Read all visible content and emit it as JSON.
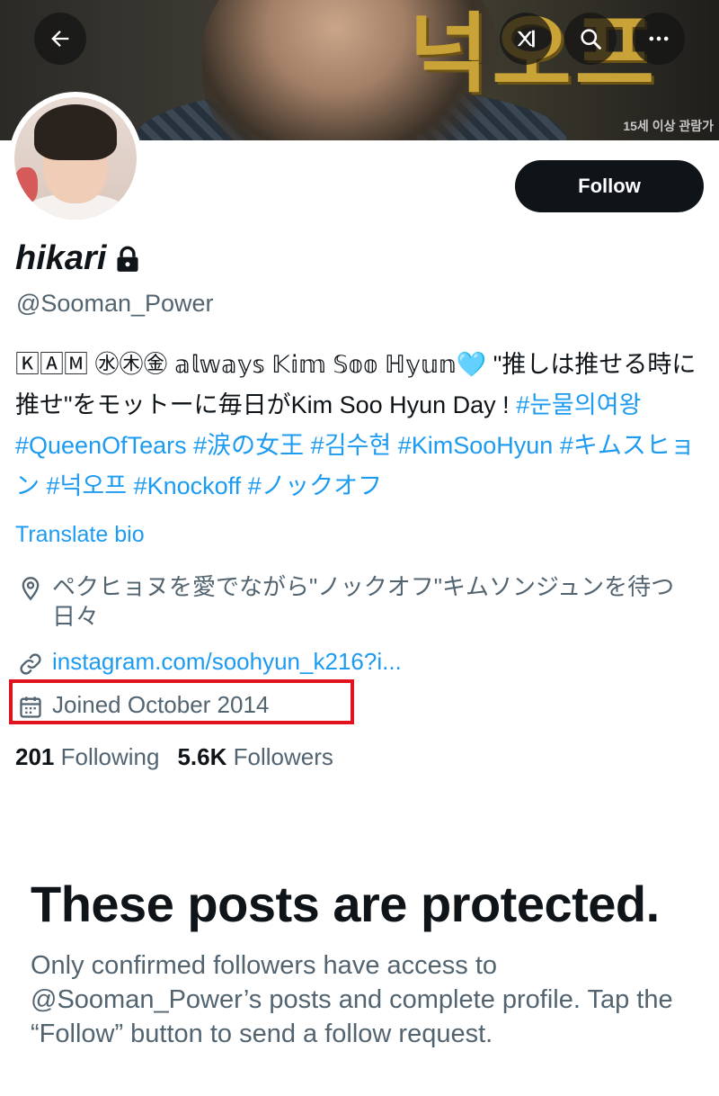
{
  "banner": {
    "art_text": "넉오프",
    "rating_text": "15세 이상 관람가"
  },
  "header_icons": [
    "back-arrow-icon",
    "grok-icon",
    "search-icon",
    "more-icon"
  ],
  "follow_button": {
    "label": "Follow"
  },
  "profile": {
    "display_name": "hikari",
    "handle": "@Sooman_Power",
    "bio_text": "🄺🄰🄼 ㊌㊍㊎ 𝕒𝕝𝕨𝕒𝕪𝕤 𝕂𝕚𝕞 𝕊𝕠𝕠 ℍ𝕪𝕦𝕟",
    "bio_heart": "🩵",
    "bio_text2": " \"推しは推せる時に推せ\"をモットーに毎日がKim Soo Hyun Day ! ",
    "hashtags": [
      "#눈물의여왕",
      "#QueenOfTears",
      "#涙の女王",
      "#김수현",
      "#KimSooHyun",
      "#キムスヒョン",
      "#넉오프",
      "#Knockoff",
      "#ノックオフ"
    ],
    "translate_label": "Translate bio",
    "location": "ペクヒョヌを愛でながら\"ノックオフ\"キムソンジュンを待つ日々",
    "website": "instagram.com/soohyun_k216?i...",
    "joined": "Joined October 2014"
  },
  "stats": {
    "following_count": "201",
    "following_label": "Following",
    "followers_count": "5.6K",
    "followers_label": "Followers"
  },
  "protected": {
    "title": "These posts are protected.",
    "body": "Only confirmed followers have access to @Sooman_Power’s posts and complete profile. Tap the “Follow” button to send a follow request."
  },
  "colors": {
    "accent": "#1d9bf0",
    "text_primary": "#0f1419",
    "text_secondary": "#536471",
    "highlight": "#e0131e"
  }
}
